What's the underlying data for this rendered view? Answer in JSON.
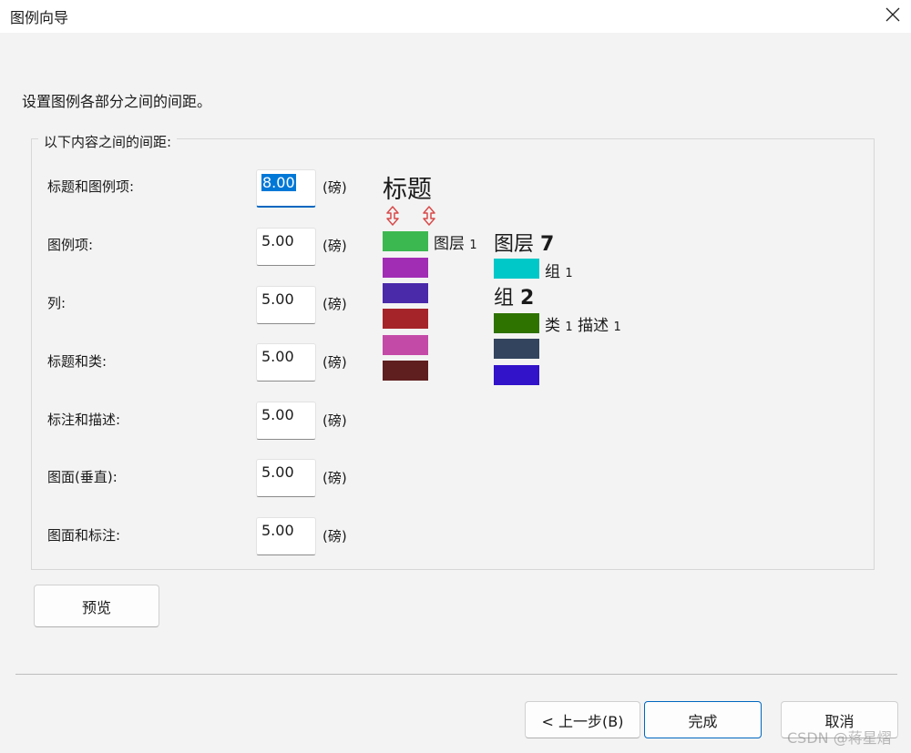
{
  "window": {
    "title": "图例向导"
  },
  "instruction": "设置图例各部分之间的间距。",
  "group": {
    "label": "以下内容之间的间距:",
    "unit": "(磅)",
    "rows": [
      {
        "label": "标题和图例项:",
        "value": "8.00"
      },
      {
        "label": "图例项:",
        "value": "5.00"
      },
      {
        "label": "列:",
        "value": "5.00"
      },
      {
        "label": "标题和类:",
        "value": "5.00"
      },
      {
        "label": "标注和描述:",
        "value": "5.00"
      },
      {
        "label": "图面(垂直):",
        "value": "5.00"
      },
      {
        "label": "图面和标注:",
        "value": "5.00"
      }
    ]
  },
  "preview": {
    "title": "标题",
    "col1": {
      "layer": "图层",
      "layer_num": "1",
      "swatch_colors": [
        "#3cb850",
        "#a22db5",
        "#4a2aa9",
        "#a52429",
        "#c44aa8",
        "#5f1f1f"
      ]
    },
    "col2": {
      "layer_heading": "图层",
      "layer_heading_num": "7",
      "group1_label": "组",
      "group1_num": "1",
      "group2_heading": "组",
      "group2_heading_num": "2",
      "class_label": "类",
      "class_num": "1",
      "desc_label": "描述",
      "desc_num": "1",
      "swatch_colors": [
        "#00c8c8",
        "#2e7200",
        "#33445e",
        "#3213c9"
      ]
    },
    "arrow_color": "#d94a4a"
  },
  "buttons": {
    "preview": "预览",
    "back": "< 上一步(B)",
    "finish": "完成",
    "cancel": "取消"
  },
  "watermark": "CSDN @蒋星熠"
}
